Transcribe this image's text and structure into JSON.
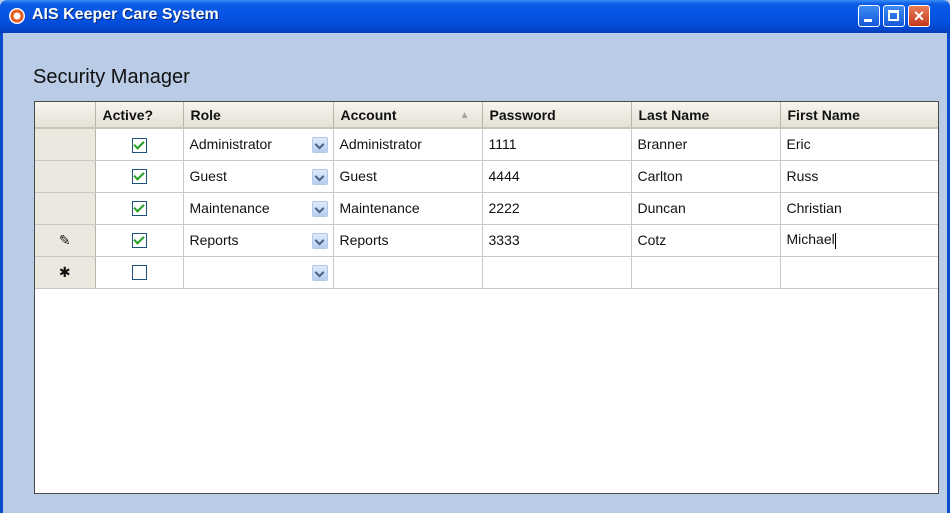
{
  "window": {
    "title": "AIS Keeper Care System"
  },
  "page": {
    "title": "Security Manager"
  },
  "grid": {
    "columns": [
      "Active?",
      "Role",
      "Account",
      "Password",
      "Last Name",
      "First Name"
    ],
    "sort_indicator": "▲",
    "rows": [
      {
        "marker": "",
        "active": true,
        "role": "Administrator",
        "account": "Administrator",
        "password": "1111",
        "last_name": "Branner",
        "first_name": "Eric"
      },
      {
        "marker": "",
        "active": true,
        "role": "Guest",
        "account": "Guest",
        "password": "4444",
        "last_name": "Carlton",
        "first_name": "Russ"
      },
      {
        "marker": "",
        "active": true,
        "role": "Maintenance",
        "account": "Maintenance",
        "password": "2222",
        "last_name": "Duncan",
        "first_name": "Christian"
      },
      {
        "marker": "✎",
        "active": true,
        "role": "Reports",
        "account": "Reports",
        "password": "3333",
        "last_name": "Cotz",
        "first_name": "Michael"
      },
      {
        "marker": "✱",
        "active": false,
        "role": "",
        "account": "",
        "password": "",
        "last_name": "",
        "first_name": ""
      }
    ]
  },
  "icons": {
    "app": "app-logo-icon",
    "minimize": "minimize-icon",
    "maximize": "maximize-icon",
    "close": "close-icon",
    "dropdown": "chevron-down-icon",
    "edit_row": "pencil-icon",
    "new_row": "asterisk-icon"
  }
}
